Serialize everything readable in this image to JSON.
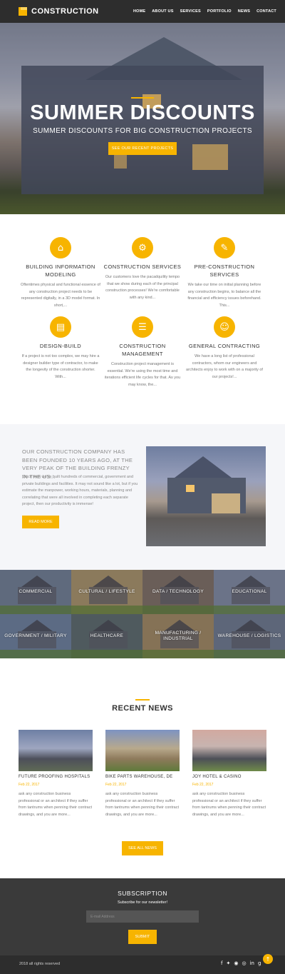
{
  "header": {
    "logo_text": "CONSTRUCTION",
    "nav": [
      "HOME",
      "ABOUT US",
      "SERVICES",
      "PORTFOLIO",
      "NEWS",
      "CONTACT"
    ]
  },
  "hero": {
    "title": "SUMMER DISCOUNTS",
    "subtitle": "SUMMER DISCOUNTS FOR BIG CONSTRUCTION PROJECTS",
    "button": "SEE OUR RECENT PROJECTS"
  },
  "services": [
    {
      "icon": "bim-icon",
      "glyph": "⌂",
      "title": "BUILDING INFORMATION MODELING",
      "text": "Oftentimes physical and functional essence of any construction project needs to be represented digitally, in a 3D model format. In short,..."
    },
    {
      "icon": "construction-services-icon",
      "glyph": "⚙",
      "title": "CONSTRUCTION SERVICES",
      "text": "Our customers love the pacadquility tempo that we show during each of the principal construction processes! We're comfortable with any kind..."
    },
    {
      "icon": "pencil-icon",
      "glyph": "✎",
      "title": "PRE-CONSTRUCTION SERVICES",
      "text": "We take our time on initial planning before any construction begins, to balance all the financial and efficiency issues beforehand. This..."
    },
    {
      "icon": "design-build-icon",
      "glyph": "▤",
      "title": "DESIGN-BUILD",
      "text": "If a project is not too complex, we may hire a designer builder type of contractor, to make the longevity of the construction shorter. With..."
    },
    {
      "icon": "clipboard-icon",
      "glyph": "☰",
      "title": "CONSTRUCTION MANAGEMENT",
      "text": "Construction project management is essential. We're using the most time and iterations efficient life cycles for that. As you may know, the..."
    },
    {
      "icon": "user-icon",
      "glyph": "☺",
      "title": "GENERAL CONTRACTING",
      "text": "We have a long list of professional contractors, whom our engineers and architects enjoy to work with on a majority of our projects!..."
    }
  ],
  "about": {
    "heading": "OUR CONSTRUCTION COMPANY HAS BEEN FOUNDED 10 YEARS AGO, AT THE VERY PEAK OF THE BUILDING FRENZY IN THE US...",
    "text": "Since then we've built hundreds of commercial, government and private buildings and facilities. It may not sound like a lot, but if you estimate the manpower, working hours, materials, planning and correlating that were all involved in completing each separate project, then our productivity is immense!",
    "button": "READ MORE"
  },
  "categories": [
    {
      "label": "COMMERCIAL",
      "color": "#5f6a7d"
    },
    {
      "label": "CULTURAL / LIFESTYLE",
      "color": "#8b7a5c"
    },
    {
      "label": "DATA / TECHNOLOGY",
      "color": "#6a5e58"
    },
    {
      "label": "EDUCATIONAL",
      "color": "#6b7388"
    },
    {
      "label": "GOVERNMENT / MILITARY",
      "color": "#5c6b84"
    },
    {
      "label": "HEALTHCARE",
      "color": "#4f5a5e"
    },
    {
      "label": "MANUFACTURING / INDUSTRIAL",
      "color": "#857256"
    },
    {
      "label": "WAREHOUSE / LOGISTICS",
      "color": "#5d6679"
    }
  ],
  "news": {
    "title": "RECENT NEWS",
    "items": [
      {
        "title": "FUTURE PROOFING HOSPITALS",
        "date": "Feb 22, 2017",
        "text": "ask any construction business professional or an architect if they suffer from tantrums when penning their contract drawings, and you are more..."
      },
      {
        "title": "BIKE PARTS WAREHOUSE, DE",
        "date": "Feb 22, 2017",
        "text": "ask any construction business professional or an architect if they suffer from tantrums when penning their contract drawings, and you are more..."
      },
      {
        "title": "JOY HOTEL & CASINO",
        "date": "Feb 22, 2017",
        "text": "ask any construction business professional or an architect if they suffer from tantrums when penning their contract drawings, and you are more..."
      }
    ],
    "button": "SEE ALL NEWS"
  },
  "subscription": {
    "title": "SUBSCRIPTION",
    "subtitle": "Subscribe for our newsletter!",
    "placeholder": "E-mail Address",
    "button": "SUBMIT"
  },
  "footer": {
    "copyright": "2018 all rights reserved",
    "social": [
      "f",
      "t",
      "rss",
      "ig",
      "in",
      "g+"
    ]
  },
  "colors": {
    "accent": "#f7b400",
    "dark": "#2d2d2d"
  }
}
